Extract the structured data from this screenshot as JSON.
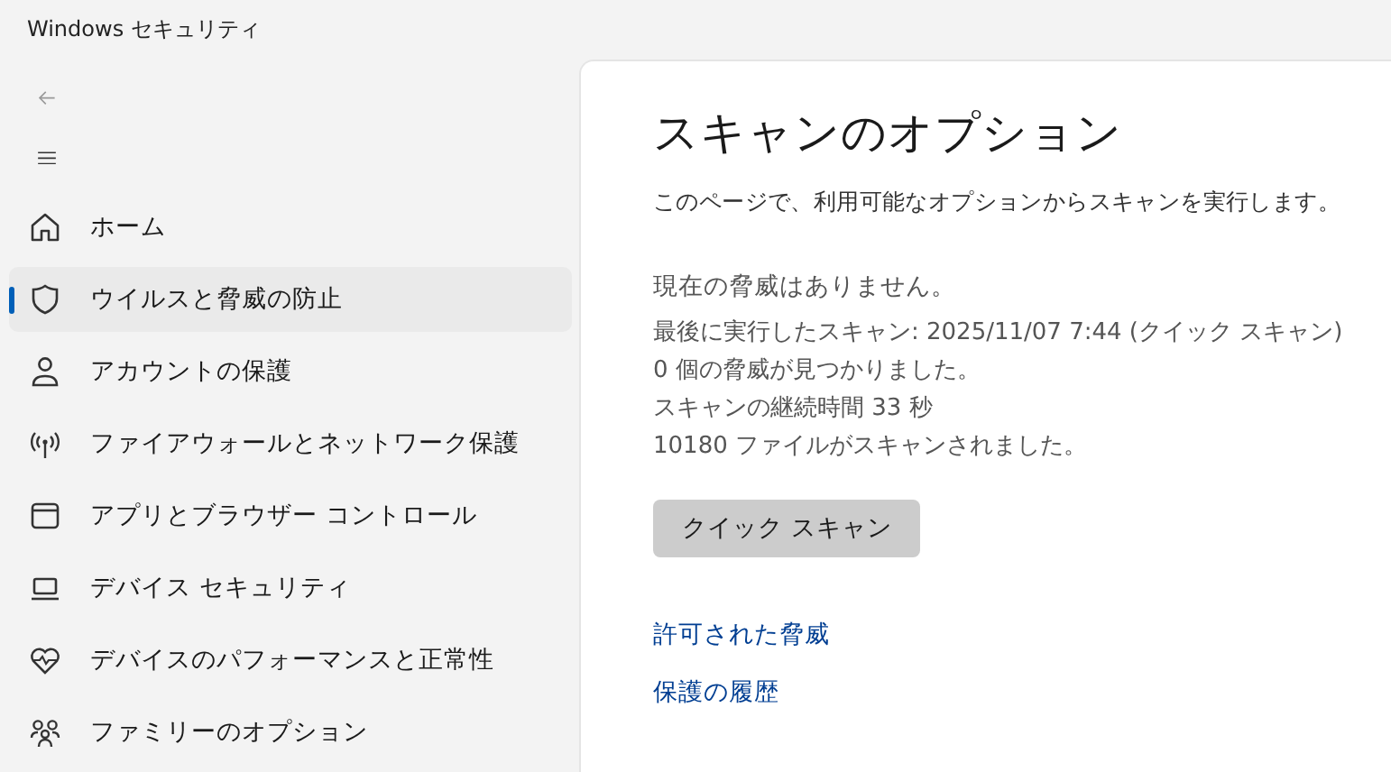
{
  "window": {
    "title": "Windows セキュリティ"
  },
  "sidebar": {
    "items": [
      {
        "label": "ホーム",
        "selected": false
      },
      {
        "label": "ウイルスと脅威の防止",
        "selected": true
      },
      {
        "label": "アカウントの保護",
        "selected": false
      },
      {
        "label": "ファイアウォールとネットワーク保護",
        "selected": false
      },
      {
        "label": "アプリとブラウザー コントロール",
        "selected": false
      },
      {
        "label": "デバイス セキュリティ",
        "selected": false
      },
      {
        "label": "デバイスのパフォーマンスと正常性",
        "selected": false
      },
      {
        "label": "ファミリーのオプション",
        "selected": false
      }
    ]
  },
  "content": {
    "title": "スキャンのオプション",
    "description": "このページで、利用可能なオプションからスキャンを実行します。",
    "status": "現在の脅威はありません。",
    "details": [
      "最後に実行したスキャン: 2025/11/07 7:44 (クイック スキャン)",
      "0 個の脅威が見つかりました。",
      "スキャンの継続時間 33 秒",
      "10180 ファイルがスキャンされました。"
    ],
    "button": "クイック スキャン",
    "links": [
      "許可された脅威",
      "保護の履歴"
    ]
  }
}
